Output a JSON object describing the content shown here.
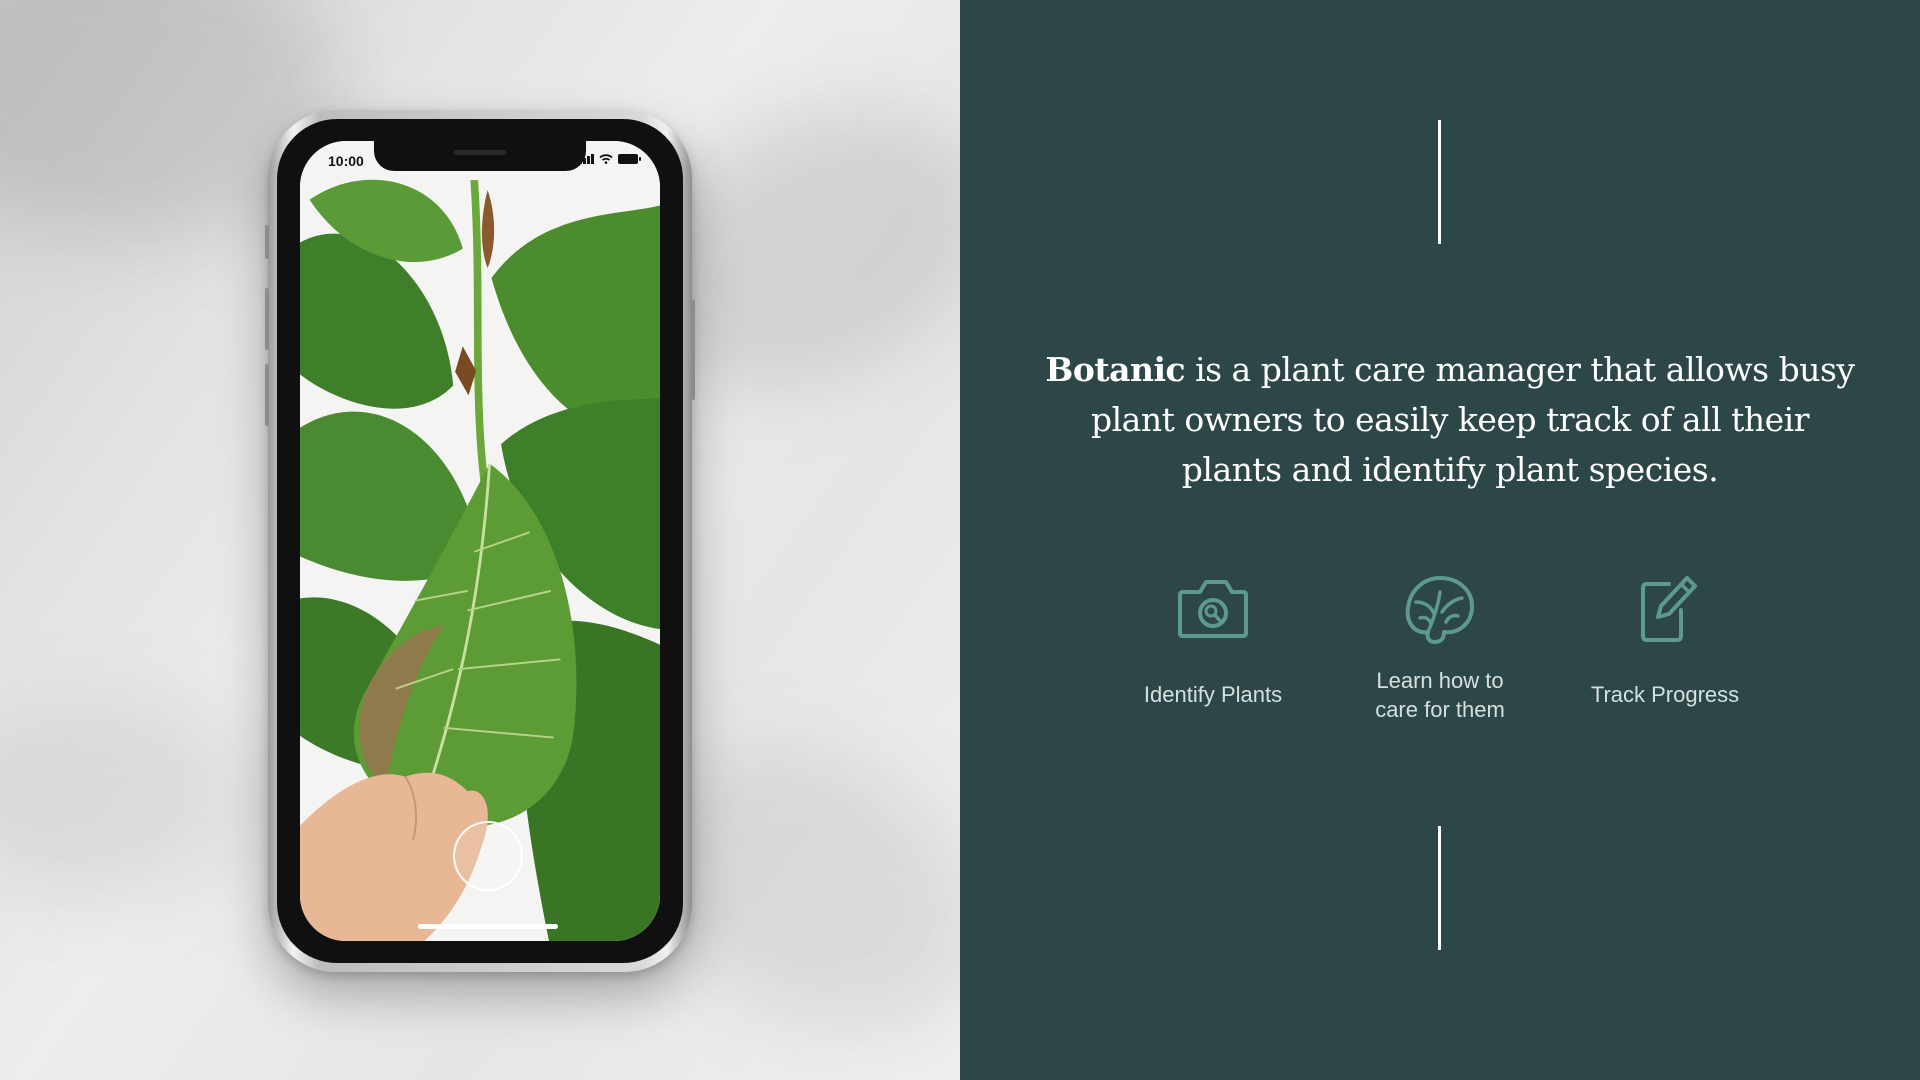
{
  "phone": {
    "status_time": "10:00"
  },
  "description": {
    "brand": "Botanic",
    "text": " is a plant care manager that allows busy plant owners to easily keep track of all their plants and identify plant species."
  },
  "features": [
    {
      "icon": "camera-search-icon",
      "label": "Identify Plants"
    },
    {
      "icon": "leaf-icon",
      "label": "Learn how to\ncare for them"
    },
    {
      "icon": "edit-note-icon",
      "label": "Track Progress"
    }
  ],
  "colors": {
    "panel_background": "#2d4648",
    "accent_icon": "#5d9a8e",
    "label_text": "#d4e0de"
  }
}
